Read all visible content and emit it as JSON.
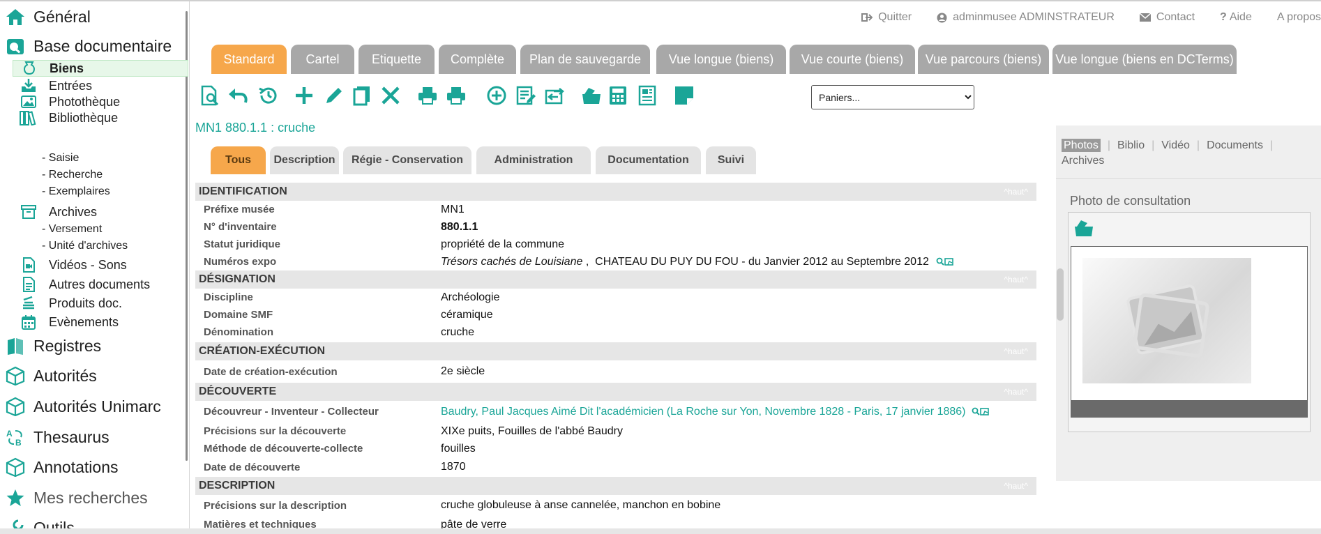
{
  "sidebar": {
    "general": "Général",
    "base": "Base documentaire",
    "biens": "Biens",
    "entrees": "Entrées",
    "phototheque": "Photothèque",
    "bibliotheque": "Bibliothèque",
    "saisie": "- Saisie",
    "recherche": "- Recherche",
    "exemplaires": "- Exemplaires",
    "archives": "Archives",
    "versement": "- Versement",
    "unite": "- Unité d'archives",
    "videos": "Vidéos - Sons",
    "autres": "Autres documents",
    "produits": "Produits doc.",
    "evenements": "Evènements",
    "registres": "Registres",
    "autorites": "Autorités",
    "autorites_unimarc": "Autorités Unimarc",
    "thesaurus": "Thesaurus",
    "annotations": "Annotations",
    "mes_recherches": "Mes recherches",
    "outils": "Outils"
  },
  "topnav": {
    "quitter": "Quitter",
    "user": "adminmusee ADMINSTRATEUR",
    "contact": "Contact",
    "aide": "Aide",
    "apropos": "A propos"
  },
  "view_tabs": [
    "Standard",
    "Cartel",
    "Etiquette",
    "Complète",
    "Plan de sauvegarde",
    "Vue longue (biens)",
    "Vue courte (biens)",
    "Vue parcours (biens)",
    "Vue longue (biens en DCTerms)"
  ],
  "paniers": "Paniers...",
  "object": {
    "number": "MN1 880.1.1",
    "sep": " : ",
    "name": "cruche"
  },
  "sub_tabs": [
    "Tous",
    "Description",
    "Régie - Conservation",
    "Administration",
    "Documentation",
    "Suivi"
  ],
  "haut": "^haut^",
  "sections": {
    "identification": "IDENTIFICATION",
    "designation": "DÉSIGNATION",
    "creation": "CRÉATION-EXÉCUTION",
    "decouverte": "DÉCOUVERTE",
    "description": "DESCRIPTION"
  },
  "fields": {
    "prefixe": {
      "label": "Préfixe musée",
      "value": "MN1"
    },
    "inventaire": {
      "label": "N° d'inventaire",
      "value": "880.1.1"
    },
    "statut": {
      "label": "Statut juridique",
      "value": "propriété de la commune"
    },
    "expo": {
      "label": "Numéros expo",
      "title": "Trésors cachés de Louisiane",
      "rest": " ,  CHATEAU DU PUY DU FOU - du Janvier 2012 au Septembre 2012"
    },
    "discipline": {
      "label": "Discipline",
      "value": "Archéologie"
    },
    "domaine": {
      "label": "Domaine SMF",
      "value": "céramique"
    },
    "denomination": {
      "label": "Dénomination",
      "value": "cruche"
    },
    "date_creation": {
      "label": "Date de création-exécution",
      "value": "2e siècle"
    },
    "decouvreur": {
      "label": "Découvreur - Inventeur - Collecteur",
      "value": "Baudry, Paul Jacques Aimé Dit l'académicien (La Roche sur Yon, Novembre 1828 - Paris, 17 janvier 1886)"
    },
    "precisions_decouverte": {
      "label": "Précisions sur la découverte",
      "value": "XIXe puits, Fouilles de l'abbé Baudry"
    },
    "methode": {
      "label": "Méthode de découverte-collecte",
      "value": "fouilles"
    },
    "date_decouverte": {
      "label": "Date de découverte",
      "value": "1870"
    },
    "precisions_description": {
      "label": "Précisions sur la description",
      "value": "cruche globuleuse à anse cannelée, manchon en bobine"
    },
    "matieres": {
      "label": "Matières et techniques",
      "value": "pâte de verre"
    }
  },
  "right_panel": {
    "tabs": {
      "photos": "Photos",
      "biblio": "Biblio",
      "video": "Vidéo",
      "documents": "Documents",
      "archives": "Archives",
      "sep": "|"
    },
    "photo_label": "Photo de consultation"
  },
  "colors": {
    "accent": "#f6a74b",
    "teal": "#1aa597",
    "inactive_tab": "#a8a8a8"
  }
}
